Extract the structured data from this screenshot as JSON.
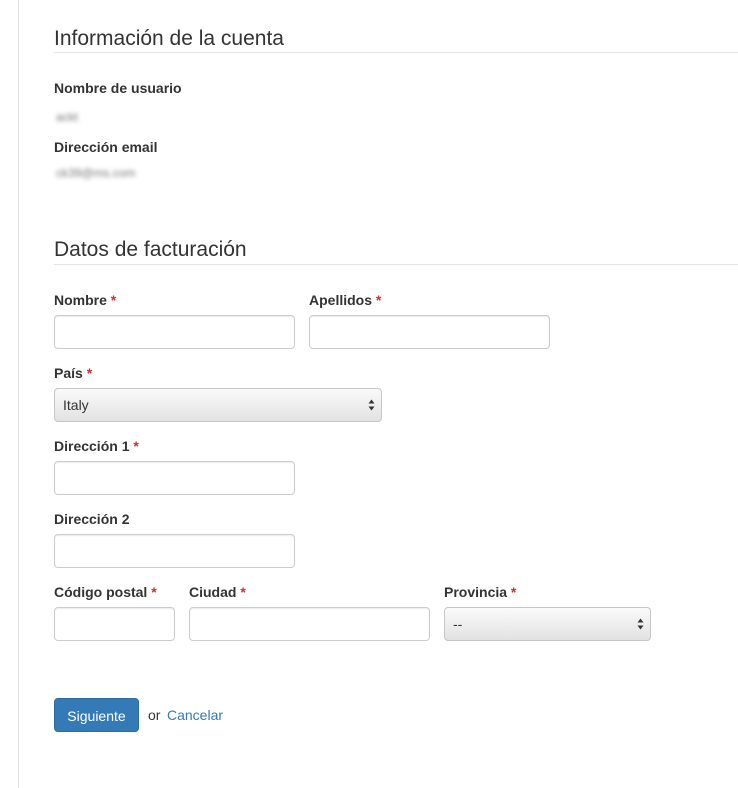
{
  "account": {
    "title": "Información de la cuenta",
    "username_label": "Nombre de usuario",
    "username_value": "ackt",
    "email_label": "Dirección email",
    "email_value": "ck39@ms.com"
  },
  "billing": {
    "title": "Datos de facturación",
    "required_mark": "*",
    "first_name": {
      "label": "Nombre",
      "value": ""
    },
    "last_name": {
      "label": "Apellidos",
      "value": ""
    },
    "country": {
      "label": "País",
      "selected": "Italy"
    },
    "address1": {
      "label": "Dirección 1",
      "value": ""
    },
    "address2": {
      "label": "Dirección 2",
      "value": ""
    },
    "postal_code": {
      "label": "Código postal",
      "value": ""
    },
    "city": {
      "label": "Ciudad",
      "value": ""
    },
    "province": {
      "label": "Provincia",
      "selected": "--"
    }
  },
  "actions": {
    "next_label": "Siguiente",
    "or_text": "or",
    "cancel_label": "Cancelar"
  },
  "colors": {
    "primary": "#337ab7",
    "required": "#c9302c"
  }
}
